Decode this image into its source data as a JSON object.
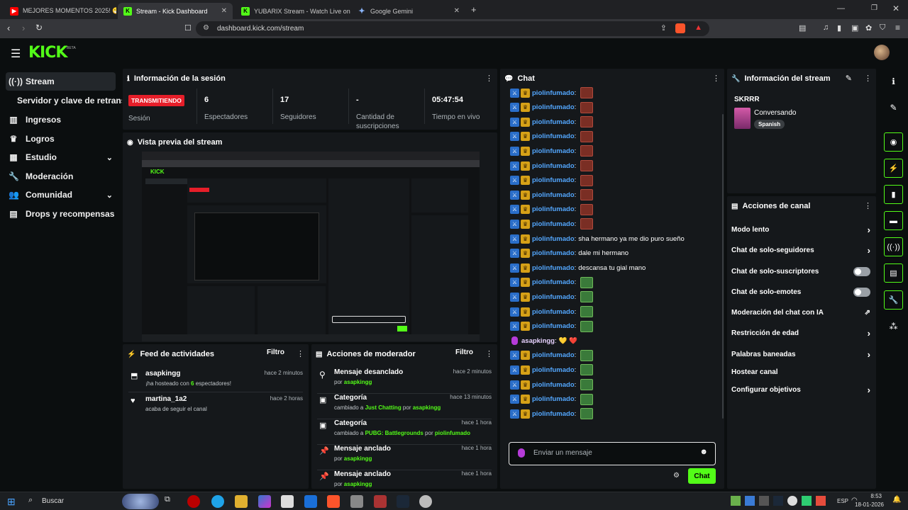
{
  "browser": {
    "tabs": [
      {
        "label": "MEJORES MOMENTOS 2025! 😁 (",
        "active": false
      },
      {
        "label": "Stream - Kick Dashboard",
        "active": true
      },
      {
        "label": "YUBARIX Stream - Watch Live on Kick",
        "active": false
      },
      {
        "label": "Google Gemini",
        "active": false
      }
    ],
    "url": "dashboard.kick.com/stream"
  },
  "header": {
    "logo": "KICK",
    "logo_sup": "BETA"
  },
  "sidebar": {
    "items": [
      {
        "label": "Stream",
        "icon": "stream-icon"
      },
      {
        "label": "Servidor y clave de retransm",
        "icon": ""
      },
      {
        "label": "Ingresos",
        "icon": "income-icon"
      },
      {
        "label": "Logros",
        "icon": "trophy-icon"
      },
      {
        "label": "Estudio",
        "icon": "studio-icon"
      },
      {
        "label": "Moderación",
        "icon": "wrench-icon"
      },
      {
        "label": "Comunidad",
        "icon": "community-icon"
      },
      {
        "label": "Drops y recompensas",
        "icon": "drops-icon"
      }
    ]
  },
  "session": {
    "title": "Información de la sesión",
    "live_badge": "TRANSMITIENDO",
    "session_label": "Sesión",
    "stats": [
      {
        "value": "6",
        "label": "Espectadores"
      },
      {
        "value": "17",
        "label": "Seguidores"
      },
      {
        "value": "-",
        "label": "Cantidad de suscripciones"
      },
      {
        "value": "05:47:54",
        "label": "Tiempo en vivo"
      }
    ]
  },
  "preview": {
    "title": "Vista previa del stream"
  },
  "chat": {
    "title": "Chat",
    "messages": [
      {
        "user": "piolinfumado",
        "text": "",
        "emote": "red"
      },
      {
        "user": "piolinfumado",
        "text": "",
        "emote": "red"
      },
      {
        "user": "piolinfumado",
        "text": "",
        "emote": "red"
      },
      {
        "user": "piolinfumado",
        "text": "",
        "emote": "red"
      },
      {
        "user": "piolinfumado",
        "text": "",
        "emote": "red"
      },
      {
        "user": "piolinfumado",
        "text": "",
        "emote": "red"
      },
      {
        "user": "piolinfumado",
        "text": "",
        "emote": "red"
      },
      {
        "user": "piolinfumado",
        "text": "",
        "emote": "red"
      },
      {
        "user": "piolinfumado",
        "text": "",
        "emote": "red"
      },
      {
        "user": "piolinfumado",
        "text": "",
        "emote": "red"
      },
      {
        "user": "piolinfumado",
        "text": "sha hermano ya me dio puro sueño",
        "emote": ""
      },
      {
        "user": "piolinfumado",
        "text": "dale mi hermano",
        "emote": ""
      },
      {
        "user": "piolinfumado",
        "text": "descansa tu gial mano",
        "emote": ""
      },
      {
        "user": "piolinfumado",
        "text": "",
        "emote": "frog"
      },
      {
        "user": "piolinfumado",
        "text": "",
        "emote": "frog"
      },
      {
        "user": "piolinfumado",
        "text": "",
        "emote": "frog"
      },
      {
        "user": "piolinfumado",
        "text": "",
        "emote": "frog"
      },
      {
        "user": "asapkingg",
        "text": "💛 ❤️",
        "emote": "",
        "special": true
      },
      {
        "user": "piolinfumado",
        "text": "",
        "emote": "frog"
      },
      {
        "user": "piolinfumado",
        "text": "",
        "emote": "frog"
      },
      {
        "user": "piolinfumado",
        "text": "",
        "emote": "frog"
      },
      {
        "user": "piolinfumado",
        "text": "",
        "emote": "frog"
      },
      {
        "user": "piolinfumado",
        "text": "",
        "emote": "frog"
      }
    ],
    "input_placeholder": "Enviar un mensaje",
    "send_label": "Chat"
  },
  "stream_info": {
    "title": "Información del stream",
    "stream_title": "SKRRR",
    "category": "Conversando",
    "language": "Spanish"
  },
  "channel_actions": {
    "title": "Acciones de canal",
    "items": [
      {
        "label": "Modo lento",
        "control": "chevron"
      },
      {
        "label": "Chat de solo-seguidores",
        "control": "chevron"
      },
      {
        "label": "Chat de solo-suscriptores",
        "control": "toggle"
      },
      {
        "label": "Chat de solo-emotes",
        "control": "toggle"
      },
      {
        "label": "Moderación del chat con IA",
        "control": "external"
      },
      {
        "label": "Restricción de edad",
        "control": "chevron"
      },
      {
        "label": "Palabras baneadas",
        "control": "chevron"
      },
      {
        "label": "Hostear canal",
        "control": ""
      },
      {
        "label": "Configurar objetivos",
        "control": "chevron"
      }
    ]
  },
  "activity_feed": {
    "title": "Feed de actividades",
    "filter": "Filtro",
    "items": [
      {
        "user": "asapkingg",
        "line_pre": "¡ha hosteado con ",
        "count": "6",
        "line_post": " espectadores!",
        "time": "hace 2 minutos",
        "icon": "host-icon"
      },
      {
        "user": "martina_1a2",
        "line_pre": "acaba de seguir el canal",
        "count": "",
        "line_post": "",
        "time": "hace 2 horas",
        "icon": "heart-icon"
      }
    ]
  },
  "mod_actions": {
    "title": "Acciones de moderador",
    "filter": "Filtro",
    "items": [
      {
        "title": "Mensaje desanclado",
        "pre": "por ",
        "hl1": "asapkingg",
        "mid": "",
        "hl2": "",
        "time": "hace 2 minutos",
        "icon": "unpin-icon"
      },
      {
        "title": "Categoría",
        "pre": "cambiado a ",
        "hl1": "Just Chatting",
        "mid": " por ",
        "hl2": "asapkingg",
        "time": "hace 13 minutos",
        "icon": "category-icon"
      },
      {
        "title": "Categoría",
        "pre": "cambiado a ",
        "hl1": "PUBG: Battlegrounds",
        "mid": " por ",
        "hl2": "piolinfumado",
        "time": "hace 1 hora",
        "icon": "category-icon"
      },
      {
        "title": "Mensaje anclado",
        "pre": "por ",
        "hl1": "asapkingg",
        "mid": "",
        "hl2": "",
        "time": "hace 1 hora",
        "icon": "pin-icon"
      },
      {
        "title": "Mensaje anclado",
        "pre": "por ",
        "hl1": "asapkingg",
        "mid": "",
        "hl2": "",
        "time": "hace 1 hora",
        "icon": "pin-icon"
      }
    ]
  },
  "taskbar": {
    "search": "Buscar",
    "lang": "ESP",
    "time": "8:53",
    "date": "18-01-2026"
  },
  "colors": {
    "accent": "#53fc18",
    "live": "#e61e29",
    "username": "#53a7ff"
  }
}
